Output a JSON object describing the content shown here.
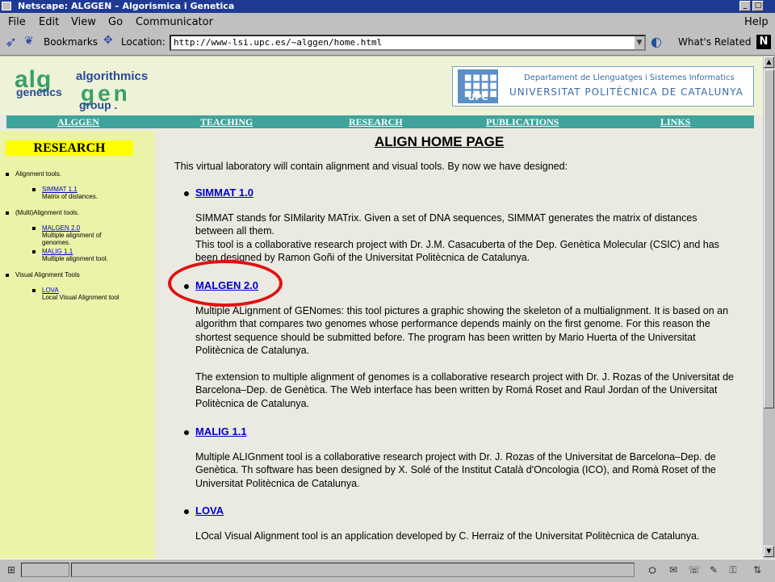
{
  "window": {
    "title": "Netscape: ALGGEN – Algorismica i Genetica"
  },
  "menu": [
    "File",
    "Edit",
    "View",
    "Go",
    "Communicator",
    "Help"
  ],
  "toolbar": {
    "bookmarks": "Bookmarks",
    "location_label": "Location:",
    "url": "http://www-lsi.upc.es/~alggen/home.html",
    "whats_related": "What's Related"
  },
  "header": {
    "logo": {
      "alg": "alg",
      "algorithmics": "algorithmics",
      "genetics": "genetics",
      "gen": "gen",
      "group": "group ."
    },
    "upc": {
      "seal_text": "UPC",
      "department": "Departament de Llenguatges i Sistemes Informatics",
      "university": "UNIVERSITAT POLITÈCNICA DE CATALUNYA"
    }
  },
  "nav": [
    "ALGGEN",
    "TEACHING",
    "RESEARCH",
    "PUBLICATIONS",
    "LINKS"
  ],
  "sidebar": {
    "heading": "RESEARCH",
    "sections": [
      {
        "label": "Alignment tools.",
        "items": [
          {
            "link": "SIMMAT 1.1",
            "desc": "Matrix of distances."
          }
        ]
      },
      {
        "label": "(Multi)Alignment tools.",
        "items": [
          {
            "link": "MALGEN 2.0",
            "desc": "Multiple alignment of genomes."
          },
          {
            "link": "MALIG 1.1",
            "desc": "Multiple alignment tool."
          }
        ]
      },
      {
        "label": "Visual Alignment Tools",
        "items": [
          {
            "link": "LOVA",
            "desc": "Local Visual Alignment tool"
          }
        ]
      }
    ]
  },
  "main": {
    "title": "ALIGN HOME PAGE",
    "intro": "This virtual laboratory will contain alignment and visual tools. By now we have designed:",
    "items": [
      {
        "name": "SIMMAT 1.0",
        "p1": "SIMMAT stands for SIMilarity MATrix. Given a set of DNA sequences, SIMMAT generates the matrix of distances between all them.",
        "p2": "This tool is a collaborative research project with Dr. J.M. Casacuberta of the Dep. Genètica Molecular (CSIC) and has been designed by Ramon Goñi of the Universitat Politècnica de Catalunya."
      },
      {
        "name": "MALGEN 2.0",
        "p1": "Multiple ALignment of GENomes: this tool pictures a graphic showing the skeleton of a multialignment. It is based on an algorithm that compares two genomes whose performance depends mainly on the first genome. For this reason the shortest sequence should be submitted before. The program has been written by Mario Huerta of the Universitat Politècnica de Catalunya.",
        "p2": "The extension to multiple alignment of genomes is a collaborative research project with Dr. J. Rozas of the Universitat de Barcelona–Dep. de Genètica. The Web interface has been written by Romá Roset and Raul Jordan of the Universitat Politècnica de Catalunya."
      },
      {
        "name": "MALIG 1.1",
        "p1": "Multiple ALIGnment tool is a collaborative research project with Dr. J. Rozas of the Universitat de Barcelona–Dep. de Genètica. Th software has been designed by X. Solé of the Institut Català d'Oncologia (ICO), and Romà Roset of the Universitat Politècnica de Catalunya."
      },
      {
        "name": "LOVA",
        "p1": "LOcal Visual Alignment tool is an application developed by C. Herraiz of the Universitat Politècnica de Catalunya."
      }
    ]
  },
  "colors": {
    "title_bar": "#1f3a93",
    "nav_bar": "#3fa39b",
    "sidebar_bg": "#eaf3a8",
    "heading_highlight": "#ffff00",
    "link": "#0000cc",
    "annotation_circle": "#e21010"
  }
}
